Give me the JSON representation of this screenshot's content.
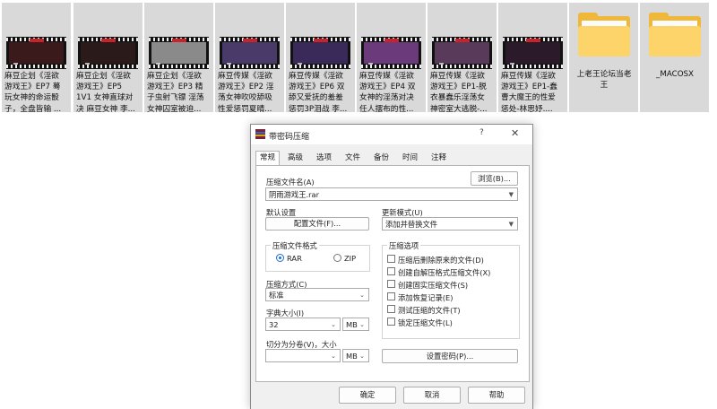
{
  "files": [
    {
      "type": "video",
      "label": "麻豆企划《淫欲\n游戏王》EP7 蓦\n玩女神的命运骰\n子，全盘皆输 ...",
      "frame_color": "#3a1a1a"
    },
    {
      "type": "video",
      "label": "麻豆企划《淫欲\n游戏王》EP5\n1V1 女神直球对\n决 麻豆女神 李...",
      "frame_color": "#2a1a1a"
    },
    {
      "type": "video",
      "label": "麻豆企划《淫欲\n游戏王》EP3 精\n子虫射飞镖 淫荡\n女神囚室被迫...",
      "frame_color": "#8a8a8a"
    },
    {
      "type": "video",
      "label": "麻豆传媒《淫欲\n游戏王》EP2 淫\n荡女神吹咬舔吸\n性爱惩罚夏晴...",
      "frame_color": "#4a3a6a"
    },
    {
      "type": "video",
      "label": "麻豆传媒《淫欲\n游戏王》EP6 双\n舔又爱抚的羞羞\n惩罚3P泪战 李...",
      "frame_color": "#3a2a5a"
    },
    {
      "type": "video",
      "label": "麻豆传媒《淫欲\n游戏王》EP4 双\n女神的淫荡对决\n任人摆布的性...",
      "frame_color": "#6a3a7a"
    },
    {
      "type": "video",
      "label": "麻豆传媒《淫欲\n游戏王》EP1-脱\n衣暴蠢乐淫荡女\n神密室大逃脱-...",
      "frame_color": "#5a3a5a"
    },
    {
      "type": "video",
      "label": "麻豆传媒《淫欲\n游戏王》EP1-蠢\n曹大魔王的性爱\n惩处-林思妤....",
      "frame_color": "#2a1a2a"
    },
    {
      "type": "folder",
      "label": "上老王论坛当老\n王"
    },
    {
      "type": "folder",
      "label": "_MACOSX"
    }
  ],
  "dialog": {
    "title": "带密码压缩",
    "help_glyph": "?",
    "close_glyph": "✕",
    "tabs": [
      "常规",
      "高级",
      "选项",
      "文件",
      "备份",
      "时间",
      "注释"
    ],
    "archive_name_label": "压缩文件名(A)",
    "browse_button": "浏览(B)...",
    "archive_name_value": "阴雨游戏王.rar",
    "default_settings_label": "默认设置",
    "profiles_button": "配置文件(F)...",
    "update_mode_label": "更新模式(U)",
    "update_mode_value": "添加并替换文件",
    "format_group_label": "压缩文件格式",
    "format_options": [
      {
        "label": "RAR",
        "selected": true
      },
      {
        "label": "ZIP",
        "selected": false
      }
    ],
    "options_group_label": "压缩选项",
    "options": [
      {
        "label": "压缩后删除原来的文件(D)",
        "checked": false
      },
      {
        "label": "创建自解压格式压缩文件(X)",
        "checked": false
      },
      {
        "label": "创建固实压缩文件(S)",
        "checked": false
      },
      {
        "label": "添加恢复记录(E)",
        "checked": false
      },
      {
        "label": "测试压缩的文件(T)",
        "checked": false
      },
      {
        "label": "锁定压缩文件(L)",
        "checked": false
      }
    ],
    "method_label": "压缩方式(C)",
    "method_value": "标准",
    "dict_label": "字典大小(I)",
    "dict_value": "32",
    "dict_unit": "MB",
    "split_label": "切分为分卷(V)，大小",
    "split_value": "",
    "split_unit": "MB",
    "set_password_button": "设置密码(P)...",
    "ok_button": "确定",
    "cancel_button": "取消",
    "help_button": "帮助"
  },
  "colors": {
    "folder": "#f0b83a",
    "folder_front": "#fcd469",
    "radio_accent": "#1e6ed1",
    "tile_bg": "#d9d9d9"
  }
}
